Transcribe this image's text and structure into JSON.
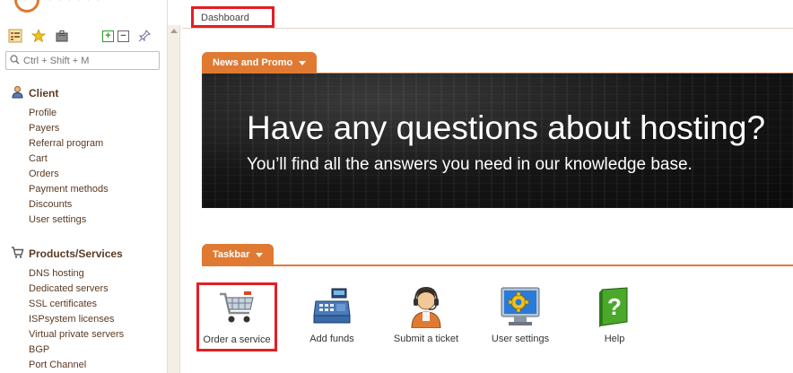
{
  "sidebar": {
    "search_placeholder": "Ctrl + Shift + M",
    "sections": [
      {
        "title": "Client",
        "icon": "client-icon",
        "items": [
          "Profile",
          "Payers",
          "Referral program",
          "Cart",
          "Orders",
          "Payment methods",
          "Discounts",
          "User settings"
        ]
      },
      {
        "title": "Products/Services",
        "icon": "cart-icon",
        "items": [
          "DNS hosting",
          "Dedicated servers",
          "SSL certificates",
          "ISPsystem licenses",
          "Virtual private servers",
          "BGP",
          "Port Channel"
        ]
      }
    ]
  },
  "main": {
    "active_tab": "Dashboard",
    "news_tab": "News and Promo",
    "banner": {
      "title": "Have any questions about hosting?",
      "subtitle": "You’ll find all the answers you need in our knowledge base."
    },
    "taskbar_tab": "Taskbar",
    "tasks": [
      {
        "label": "Order a service",
        "icon": "shopping-cart-icon"
      },
      {
        "label": "Add funds",
        "icon": "cash-register-icon"
      },
      {
        "label": "Submit a ticket",
        "icon": "support-agent-icon"
      },
      {
        "label": "User settings",
        "icon": "monitor-gear-icon"
      },
      {
        "label": "Help",
        "icon": "help-book-icon"
      }
    ]
  },
  "colors": {
    "accent": "#e07a32",
    "highlight": "#e31e24",
    "menu_text": "#5a3a22"
  }
}
